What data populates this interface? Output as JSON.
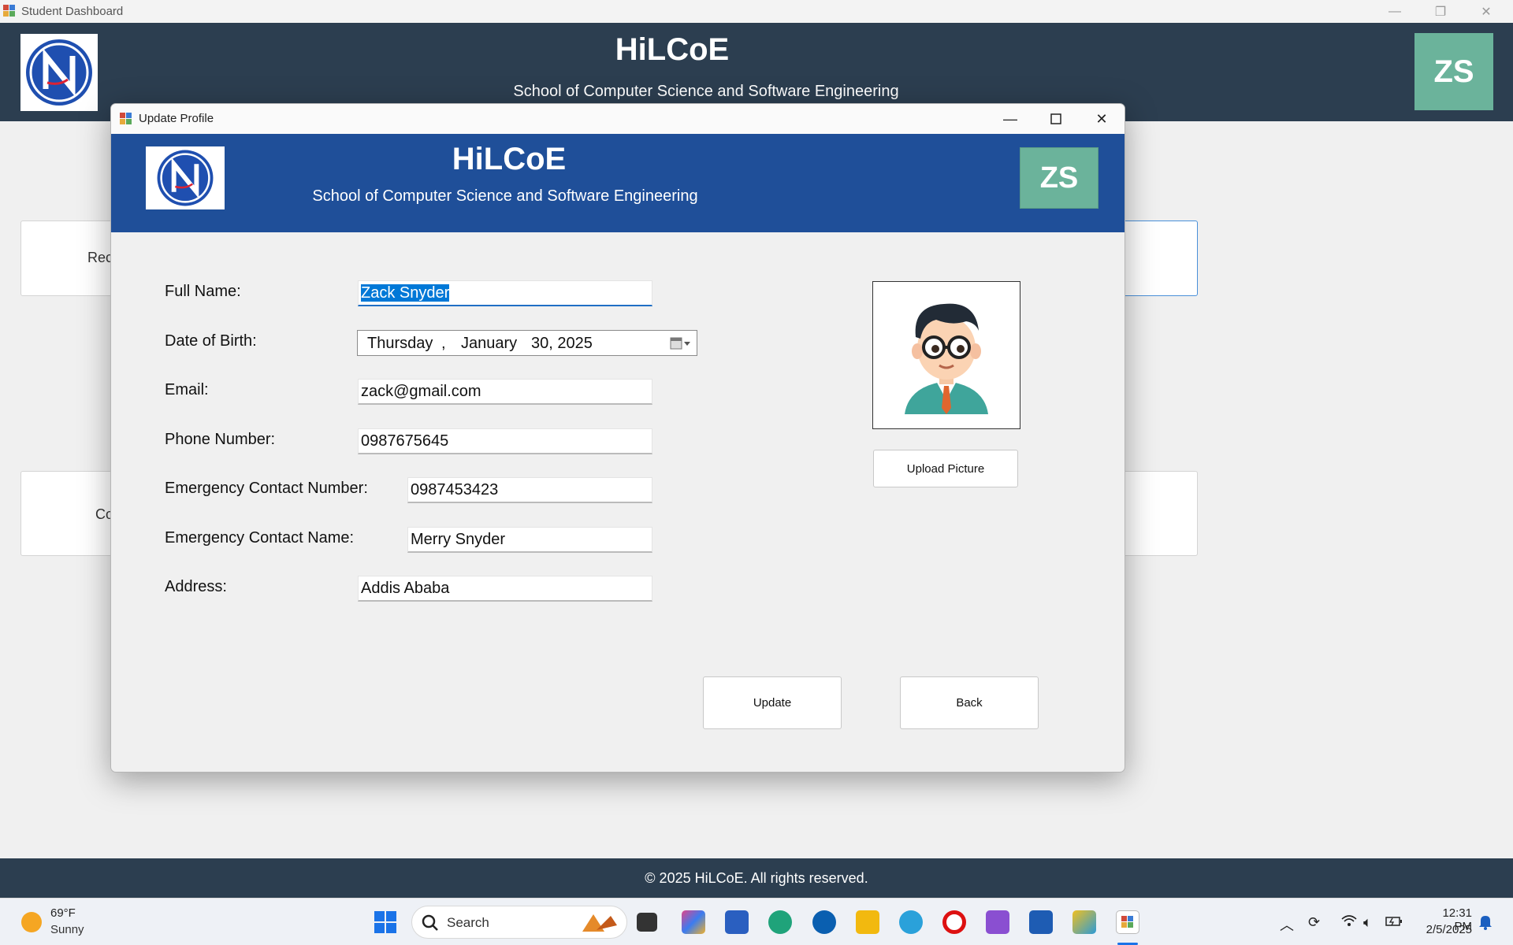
{
  "background_window": {
    "title": "Student Dashboard",
    "header_title": "HiLCoE",
    "header_subtitle": "School of Computer Science and Software Engineering",
    "avatar_initials": "ZS",
    "card_left_top_partial": "Rec",
    "card_left_bottom_partial": "Co",
    "footer": "© 2025 HiLCoE. All rights reserved."
  },
  "modal": {
    "title": "Update Profile",
    "header_title": "HiLCoE",
    "header_subtitle": "School of Computer Science and Software Engineering",
    "avatar_initials": "ZS",
    "fields": {
      "full_name": {
        "label": "Full Name:",
        "value": "Zack Snyder"
      },
      "dob": {
        "label": "Date of Birth:",
        "day": "Thursday",
        "sep": ",",
        "month": "January",
        "date_year": "30, 2025"
      },
      "email": {
        "label": "Email:",
        "value": "zack@gmail.com"
      },
      "phone": {
        "label": "Phone Number:",
        "value": "0987675645"
      },
      "emergency_number": {
        "label": "Emergency Contact Number:",
        "value": "0987453423"
      },
      "emergency_name": {
        "label": "Emergency Contact Name:",
        "value": "Merry Snyder"
      },
      "address": {
        "label": "Address:",
        "value": "Addis Ababa"
      }
    },
    "upload_button": "Upload Picture",
    "update_button": "Update",
    "back_button": "Back"
  },
  "taskbar": {
    "weather_temp": "69°F",
    "weather_condition": "Sunny",
    "search_placeholder": "Search",
    "time": "12:31 PM",
    "date": "2/5/2025",
    "pinned_icons": [
      "task-view-icon",
      "copilot-icon",
      "store-icon",
      "edge-icon",
      "dell-icon",
      "file-explorer-icon",
      "telegram-icon",
      "opera-icon",
      "visual-studio-icon",
      "word-icon",
      "snipping-tool-icon",
      "winforms-app-icon"
    ]
  },
  "colors": {
    "dashboard_header": "#2c3e50",
    "modal_header": "#1f4f99",
    "avatar": "#6bb39b",
    "selection": "#0078d7"
  }
}
